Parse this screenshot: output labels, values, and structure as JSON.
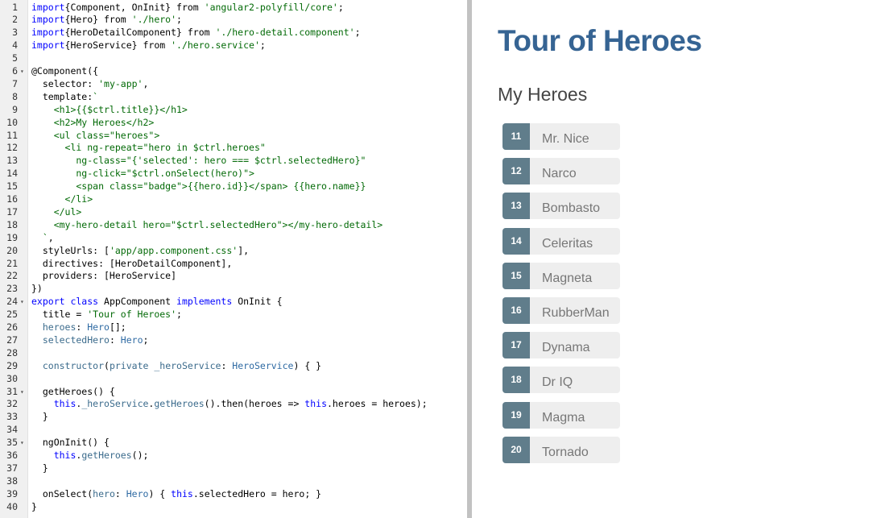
{
  "editor": {
    "lines": [
      {
        "n": "1",
        "fold": "",
        "segs": [
          [
            "kw",
            "import"
          ],
          [
            "",
            "{Component, OnInit} from "
          ],
          [
            "str",
            "'angular2-polyfill/core'"
          ],
          [
            "",
            ";"
          ]
        ]
      },
      {
        "n": "2",
        "fold": "",
        "segs": [
          [
            "kw",
            "import"
          ],
          [
            "",
            "{Hero} from "
          ],
          [
            "str",
            "'./hero'"
          ],
          [
            "",
            ";"
          ]
        ]
      },
      {
        "n": "3",
        "fold": "",
        "segs": [
          [
            "kw",
            "import"
          ],
          [
            "",
            "{HeroDetailComponent} from "
          ],
          [
            "str",
            "'./hero-detail.component'"
          ],
          [
            "",
            ";"
          ]
        ]
      },
      {
        "n": "4",
        "fold": "",
        "segs": [
          [
            "kw",
            "import"
          ],
          [
            "",
            "{HeroService} from "
          ],
          [
            "str",
            "'./hero.service'"
          ],
          [
            "",
            ";"
          ]
        ]
      },
      {
        "n": "5",
        "fold": "",
        "segs": []
      },
      {
        "n": "6",
        "fold": "▾",
        "segs": [
          [
            "dec",
            "@Component({"
          ]
        ]
      },
      {
        "n": "7",
        "fold": "",
        "segs": [
          [
            "",
            "  selector: "
          ],
          [
            "str",
            "'my-app'"
          ],
          [
            "",
            ","
          ]
        ]
      },
      {
        "n": "8",
        "fold": "",
        "segs": [
          [
            "",
            "  template:"
          ],
          [
            "str",
            "`"
          ]
        ]
      },
      {
        "n": "9",
        "fold": "",
        "segs": [
          [
            "str",
            "    <h1>{{$ctrl.title}}</h1>"
          ]
        ]
      },
      {
        "n": "10",
        "fold": "",
        "segs": [
          [
            "str",
            "    <h2>My Heroes</h2>"
          ]
        ]
      },
      {
        "n": "11",
        "fold": "",
        "segs": [
          [
            "str",
            "    <ul class=\"heroes\">"
          ]
        ]
      },
      {
        "n": "12",
        "fold": "",
        "segs": [
          [
            "str",
            "      <li ng-repeat=\"hero in $ctrl.heroes\""
          ]
        ]
      },
      {
        "n": "13",
        "fold": "",
        "segs": [
          [
            "str",
            "        ng-class=\"{'selected': hero === $ctrl.selectedHero}\""
          ]
        ]
      },
      {
        "n": "14",
        "fold": "",
        "segs": [
          [
            "str",
            "        ng-click=\"$ctrl.onSelect(hero)\">"
          ]
        ]
      },
      {
        "n": "15",
        "fold": "",
        "segs": [
          [
            "str",
            "        <span class=\"badge\">{{hero.id}}</span> {{hero.name}}"
          ]
        ]
      },
      {
        "n": "16",
        "fold": "",
        "segs": [
          [
            "str",
            "      </li>"
          ]
        ]
      },
      {
        "n": "17",
        "fold": "",
        "segs": [
          [
            "str",
            "    </ul>"
          ]
        ]
      },
      {
        "n": "18",
        "fold": "",
        "segs": [
          [
            "str",
            "    <my-hero-detail hero=\"$ctrl.selectedHero\"></my-hero-detail>"
          ]
        ]
      },
      {
        "n": "19",
        "fold": "",
        "segs": [
          [
            "str",
            "  `"
          ],
          [
            "",
            ","
          ]
        ]
      },
      {
        "n": "20",
        "fold": "",
        "segs": [
          [
            "",
            "  styleUrls: ["
          ],
          [
            "str",
            "'app/app.component.css'"
          ],
          [
            "",
            "],"
          ]
        ]
      },
      {
        "n": "21",
        "fold": "",
        "segs": [
          [
            "",
            "  directives: [HeroDetailComponent],"
          ]
        ]
      },
      {
        "n": "22",
        "fold": "",
        "segs": [
          [
            "",
            "  providers: [HeroService]"
          ]
        ]
      },
      {
        "n": "23",
        "fold": "",
        "segs": [
          [
            "",
            "})"
          ]
        ]
      },
      {
        "n": "24",
        "fold": "▾",
        "segs": [
          [
            "kw",
            "export class "
          ],
          [
            "",
            "AppComponent "
          ],
          [
            "kw",
            "implements "
          ],
          [
            "",
            "OnInit {"
          ]
        ]
      },
      {
        "n": "25",
        "fold": "",
        "segs": [
          [
            "",
            "  title = "
          ],
          [
            "str",
            "'Tour of Heroes'"
          ],
          [
            "",
            ";"
          ]
        ]
      },
      {
        "n": "26",
        "fold": "",
        "segs": [
          [
            "var",
            "  heroes"
          ],
          [
            "",
            ": "
          ],
          [
            "typ",
            "Hero"
          ],
          [
            "",
            "[];"
          ]
        ]
      },
      {
        "n": "27",
        "fold": "",
        "segs": [
          [
            "var",
            "  selectedHero"
          ],
          [
            "",
            ": "
          ],
          [
            "typ",
            "Hero"
          ],
          [
            "",
            ";"
          ]
        ]
      },
      {
        "n": "28",
        "fold": "",
        "segs": []
      },
      {
        "n": "29",
        "fold": "",
        "segs": [
          [
            "var",
            "  constructor"
          ],
          [
            "",
            "("
          ],
          [
            "var",
            "private _heroService"
          ],
          [
            "",
            ": "
          ],
          [
            "typ",
            "HeroService"
          ],
          [
            "",
            ") { }"
          ]
        ]
      },
      {
        "n": "30",
        "fold": "",
        "segs": []
      },
      {
        "n": "31",
        "fold": "▾",
        "segs": [
          [
            "",
            "  getHeroes() {"
          ]
        ]
      },
      {
        "n": "32",
        "fold": "",
        "segs": [
          [
            "kw",
            "    this"
          ],
          [
            "",
            "."
          ],
          [
            "var",
            "_heroService"
          ],
          [
            "",
            "."
          ],
          [
            "var",
            "getHeroes"
          ],
          [
            "",
            "().then(heroes => "
          ],
          [
            "kw",
            "this"
          ],
          [
            "",
            ".heroes = heroes);"
          ]
        ]
      },
      {
        "n": "33",
        "fold": "",
        "segs": [
          [
            "",
            "  }"
          ]
        ]
      },
      {
        "n": "34",
        "fold": "",
        "segs": []
      },
      {
        "n": "35",
        "fold": "▾",
        "segs": [
          [
            "",
            "  ngOnInit() {"
          ]
        ]
      },
      {
        "n": "36",
        "fold": "",
        "segs": [
          [
            "kw",
            "    this"
          ],
          [
            "",
            "."
          ],
          [
            "var",
            "getHeroes"
          ],
          [
            "",
            "();"
          ]
        ]
      },
      {
        "n": "37",
        "fold": "",
        "segs": [
          [
            "",
            "  }"
          ]
        ]
      },
      {
        "n": "38",
        "fold": "",
        "segs": []
      },
      {
        "n": "39",
        "fold": "",
        "segs": [
          [
            "",
            "  onSelect("
          ],
          [
            "var",
            "hero"
          ],
          [
            "",
            ": "
          ],
          [
            "typ",
            "Hero"
          ],
          [
            "",
            ") { "
          ],
          [
            "kw",
            "this"
          ],
          [
            "",
            ".selectedHero = hero; }"
          ]
        ]
      },
      {
        "n": "40",
        "fold": "",
        "segs": [
          [
            "",
            "}"
          ]
        ]
      }
    ]
  },
  "preview": {
    "title": "Tour of Heroes",
    "subtitle": "My Heroes",
    "heroes": [
      {
        "id": "11",
        "name": "Mr. Nice"
      },
      {
        "id": "12",
        "name": "Narco"
      },
      {
        "id": "13",
        "name": "Bombasto"
      },
      {
        "id": "14",
        "name": "Celeritas"
      },
      {
        "id": "15",
        "name": "Magneta"
      },
      {
        "id": "16",
        "name": "RubberMan"
      },
      {
        "id": "17",
        "name": "Dynama"
      },
      {
        "id": "18",
        "name": "Dr IQ"
      },
      {
        "id": "19",
        "name": "Magma"
      },
      {
        "id": "20",
        "name": "Tornado"
      }
    ]
  }
}
